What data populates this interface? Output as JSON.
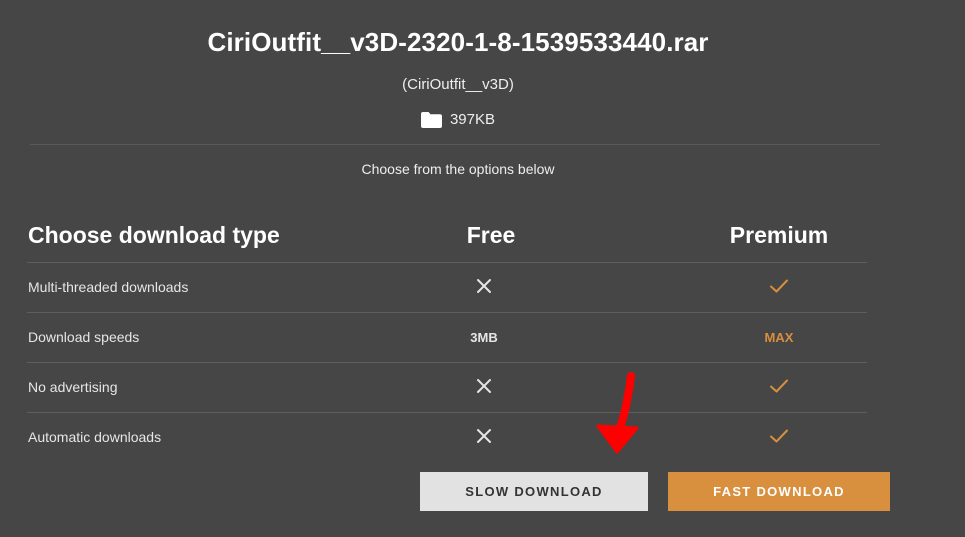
{
  "file": {
    "name": "CiriOutfit__v3D-2320-1-8-1539533440.rar",
    "subtitle": "(CiriOutfit__v3D)",
    "size": "397KB",
    "size_icon": "folder-icon"
  },
  "prompt_text": "Choose from the options below",
  "table": {
    "headers": {
      "label": "Choose download type",
      "free": "Free",
      "premium": "Premium"
    },
    "rows": [
      {
        "label": "Multi-threaded downloads",
        "free": {
          "type": "icon",
          "icon": "cross-icon"
        },
        "premium": {
          "type": "icon",
          "icon": "check-icon"
        }
      },
      {
        "label": "Download speeds",
        "free": {
          "type": "text",
          "text": "3MB"
        },
        "premium": {
          "type": "text",
          "text": "MAX"
        }
      },
      {
        "label": "No advertising",
        "free": {
          "type": "icon",
          "icon": "cross-icon"
        },
        "premium": {
          "type": "icon",
          "icon": "check-icon"
        }
      },
      {
        "label": "Automatic downloads",
        "free": {
          "type": "icon",
          "icon": "cross-icon"
        },
        "premium": {
          "type": "icon",
          "icon": "check-icon"
        }
      }
    ]
  },
  "buttons": {
    "slow": "SLOW DOWNLOAD",
    "fast": "FAST DOWNLOAD"
  },
  "annotation": {
    "icon": "red-arrow-icon",
    "color": "#ff0000"
  },
  "colors": {
    "background": "#464646",
    "accent": "#d88f3e",
    "slow_button": "#e2e2e2"
  }
}
